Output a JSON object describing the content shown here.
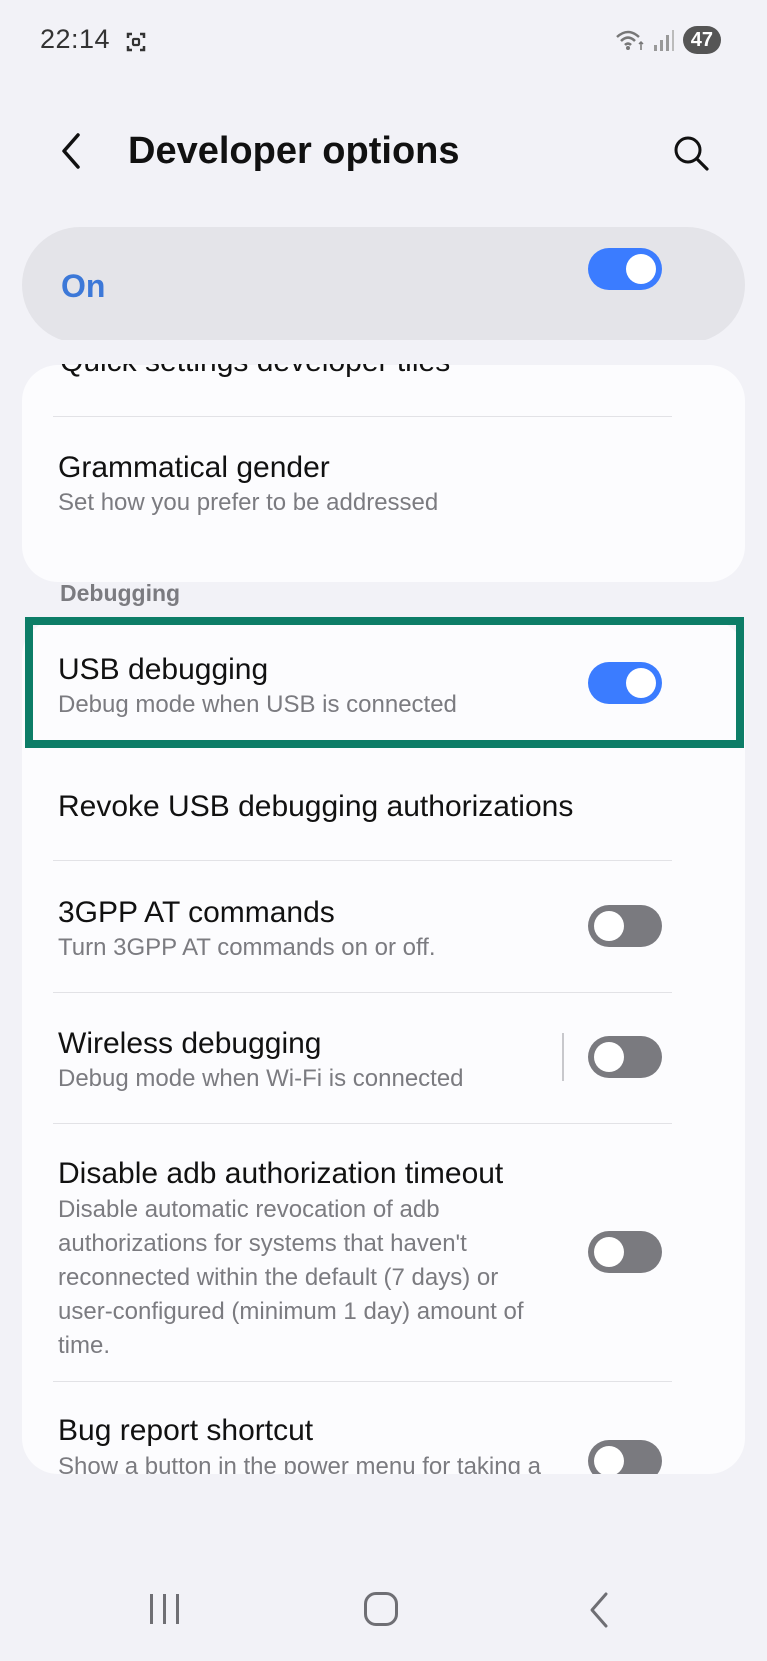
{
  "status_bar": {
    "time": "22:14",
    "battery": "47",
    "icons": [
      "screen-record-icon",
      "wifi-icon",
      "signal-icon"
    ]
  },
  "header": {
    "title": "Developer options",
    "back_icon": "chevron-left-icon",
    "search_icon": "search-icon"
  },
  "master": {
    "label": "On",
    "toggle_on": true,
    "accent": "#3b7cff"
  },
  "card1": {
    "cut_title": "Quick settings developer tiles",
    "items": [
      {
        "title": "Grammatical gender",
        "subtitle": "Set how you prefer to be addressed"
      }
    ]
  },
  "debugging": {
    "section_label": "Debugging",
    "items": [
      {
        "title": "USB debugging",
        "subtitle": "Debug mode when USB is connected",
        "toggle_on": true,
        "highlighted": true
      },
      {
        "title": "Revoke USB debugging authorizations"
      },
      {
        "title": "3GPP AT commands",
        "subtitle": "Turn 3GPP AT commands on or off.",
        "toggle_on": false
      },
      {
        "title": "Wireless debugging",
        "subtitle": "Debug mode when Wi-Fi is connected",
        "toggle_on": false
      },
      {
        "title": "Disable adb authorization timeout",
        "subtitle": "Disable automatic revocation of adb authorizations for systems that haven't reconnected within the default (7 days) or user-configured (minimum 1 day) amount of time.",
        "toggle_on": false
      },
      {
        "title": "Bug report shortcut",
        "subtitle": "Show a button in the power menu for taking a",
        "toggle_on": false
      }
    ]
  },
  "nav": {
    "icons": [
      "recents-icon",
      "home-icon",
      "back-icon"
    ]
  },
  "colors": {
    "highlight_border": "#0d7d67",
    "background": "#f2f2f7"
  }
}
